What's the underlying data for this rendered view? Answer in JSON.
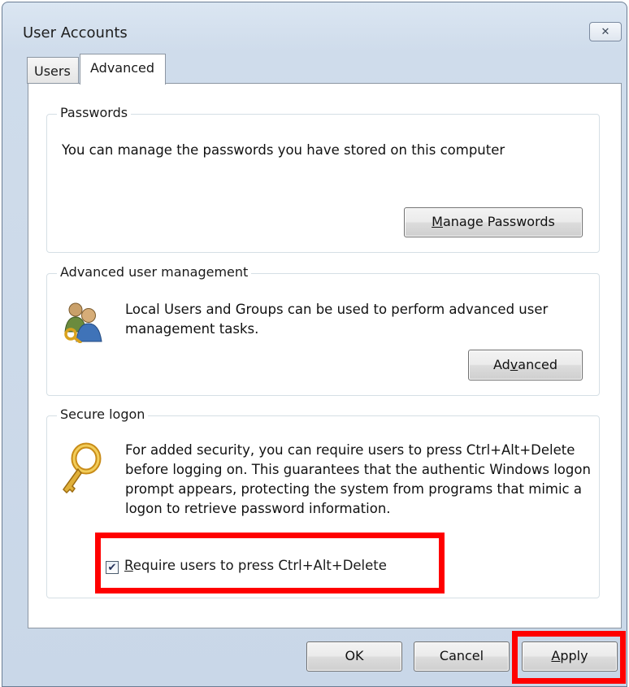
{
  "window": {
    "title": "User Accounts",
    "close_glyph": "✕"
  },
  "tabs": [
    {
      "label": "Users"
    },
    {
      "label": "Advanced",
      "selected": true
    }
  ],
  "passwords": {
    "legend": "Passwords",
    "text": "You can manage the passwords you have stored on this computer",
    "button": {
      "pre": "",
      "accel": "M",
      "post": "anage Passwords"
    }
  },
  "advanced_mgmt": {
    "legend": "Advanced user management",
    "text": "Local Users and Groups can be used to perform advanced user management tasks.",
    "icon": "users-key-icon",
    "button": {
      "pre": "Ad",
      "accel": "v",
      "post": "anced"
    }
  },
  "secure_logon": {
    "legend": "Secure logon",
    "text": "For added security, you can require users to press Ctrl+Alt+Delete before logging on. This guarantees that the authentic Windows logon prompt appears, protecting the system from programs that mimic a logon to retrieve password information.",
    "icon": "key-icon",
    "checkbox": {
      "checked": true,
      "accel": "R",
      "rest": "equire users to press Ctrl+Alt+Delete"
    }
  },
  "footer": {
    "ok": "OK",
    "cancel": "Cancel",
    "apply": {
      "accel": "A",
      "rest": "pply"
    }
  },
  "highlight_color": "#ff0000"
}
